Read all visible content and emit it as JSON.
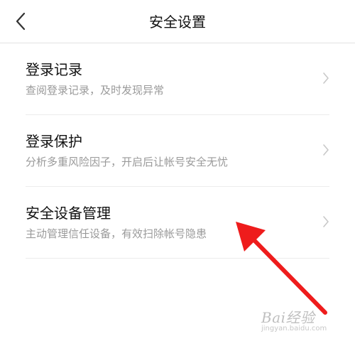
{
  "header": {
    "title": "安全设置",
    "back_icon": "chevron-left-icon"
  },
  "settings": {
    "items": [
      {
        "title": "登录记录",
        "description": "查阅登录记录，及时发现异常",
        "icon": "chevron-right-icon"
      },
      {
        "title": "登录保护",
        "description": "分析多重风险因子，开启后让帐号安全无忧",
        "icon": "chevron-right-icon"
      },
      {
        "title": "安全设备管理",
        "description": "主动管理信任设备，有效扫除帐号隐患",
        "icon": "chevron-right-icon"
      }
    ]
  },
  "annotation": {
    "arrow_color": "#ee1c1c"
  },
  "watermark": {
    "brand": "Bai经验",
    "url": "jingyan.baidu.com"
  },
  "colors": {
    "title_text": "#111111",
    "secondary_text": "#9a9a9a",
    "divider": "#ececec",
    "chevron": "#c8c8c8"
  }
}
